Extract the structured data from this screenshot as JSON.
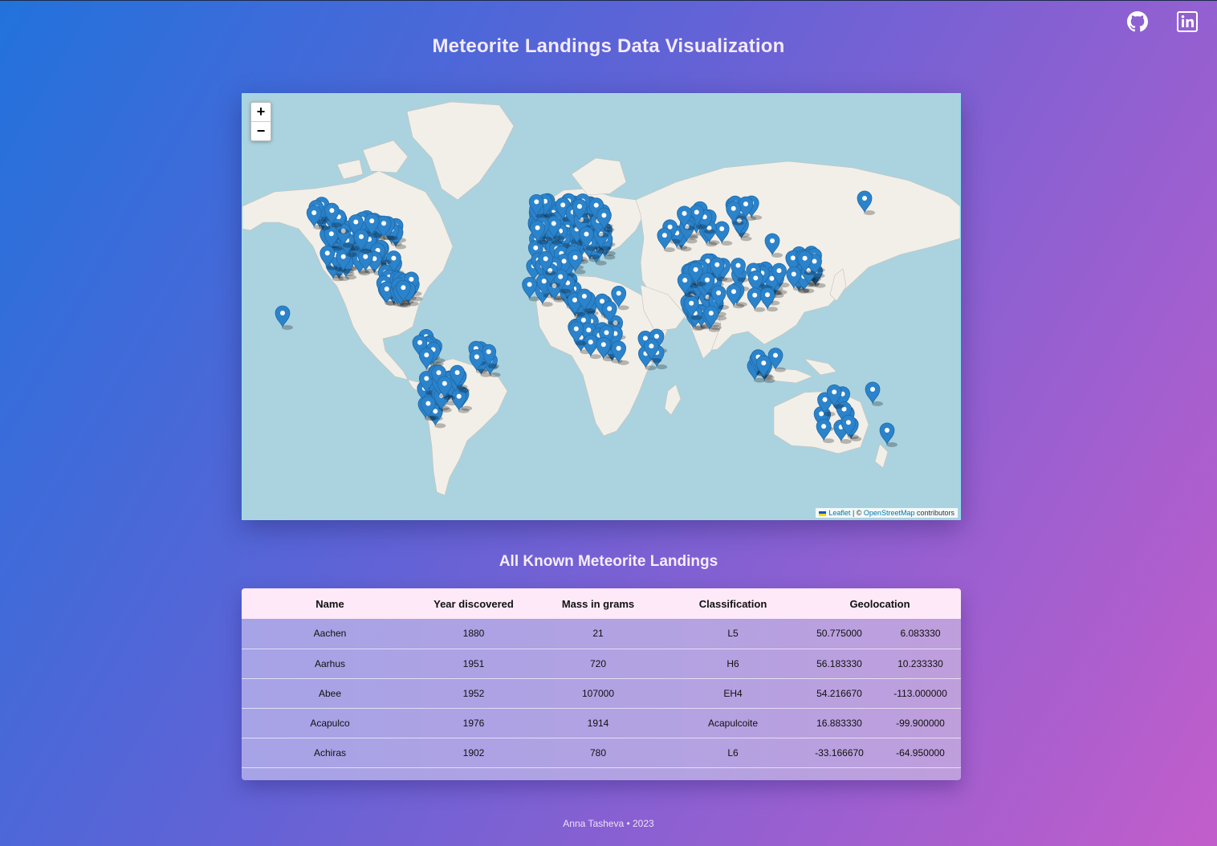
{
  "header": {
    "title": "Meteorite Landings Data Visualization",
    "github_icon": "github-icon",
    "linkedin_icon": "linkedin-icon"
  },
  "map": {
    "zoom_in": "+",
    "zoom_out": "−",
    "attribution": {
      "leaflet": "Leaflet",
      "sep": " | © ",
      "osm": "OpenStreetMap",
      "suffix": " contributors"
    },
    "marker_icon": "map-pin-icon",
    "marker_color": "#2b83cb",
    "water_color": "#aad3df",
    "land_color": "#f2efe9"
  },
  "table": {
    "title": "All Known Meteorite Landings",
    "headers": [
      "Name",
      "Year discovered",
      "Mass in grams",
      "Classification",
      "Geolocation"
    ],
    "rows": [
      {
        "name": "Aachen",
        "year": "1880",
        "mass": "21",
        "class": "L5",
        "lat": "50.775000",
        "lng": "6.083330"
      },
      {
        "name": "Aarhus",
        "year": "1951",
        "mass": "720",
        "class": "H6",
        "lat": "56.183330",
        "lng": "10.233330"
      },
      {
        "name": "Abee",
        "year": "1952",
        "mass": "107000",
        "class": "EH4",
        "lat": "54.216670",
        "lng": "-113.000000"
      },
      {
        "name": "Acapulco",
        "year": "1976",
        "mass": "1914",
        "class": "Acapulcoite",
        "lat": "16.883330",
        "lng": "-99.900000"
      },
      {
        "name": "Achiras",
        "year": "1902",
        "mass": "780",
        "class": "L6",
        "lat": "-33.166670",
        "lng": "-64.950000"
      }
    ]
  },
  "footer": {
    "text": "Anna Tasheva • 2023"
  }
}
